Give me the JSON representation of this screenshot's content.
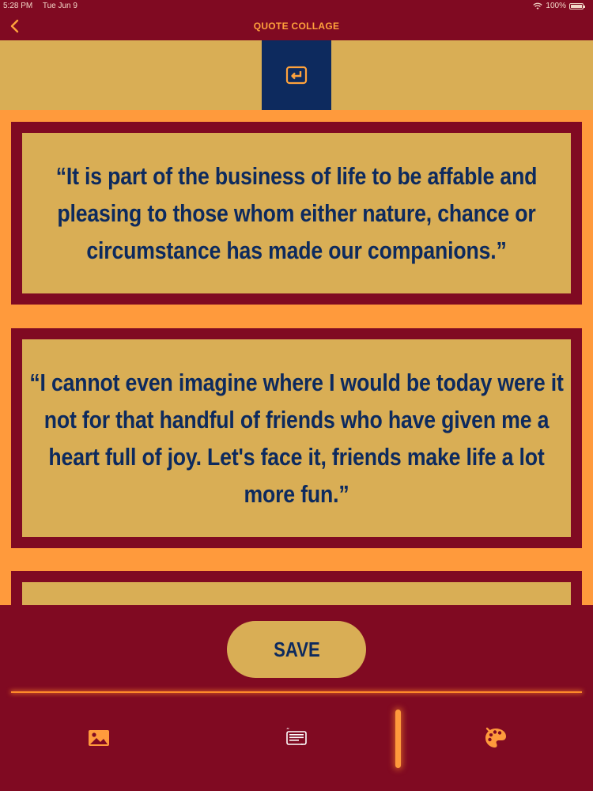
{
  "status_bar": {
    "time": "5:28 PM",
    "date": "Tue Jun 9",
    "battery": "100%"
  },
  "nav": {
    "title": "QUOTE COLLAGE",
    "back_icon": "chevron-left-icon"
  },
  "toolbar": {
    "toggle_icon": "return-arrow-icon"
  },
  "quotes": [
    {
      "text": "“It is part of the business of life to be affable and pleasing to those whom either nature, chance or circumstance has made our companions.”"
    },
    {
      "text": "“I cannot even imagine where I would be today were it not for that handful of friends who have given me a heart full of joy. Let's face it, friends make life a lot more fun.”"
    },
    {
      "text": ""
    }
  ],
  "bottom": {
    "save_label": "SAVE",
    "tabs": [
      {
        "icon": "image-icon"
      },
      {
        "icon": "quote-text-icon"
      },
      {
        "icon": "palette-icon"
      }
    ]
  },
  "colors": {
    "maroon": "#800A22",
    "gold": "#D9AE55",
    "orange": "#FF9A3C",
    "navy": "#0D2A5E"
  }
}
